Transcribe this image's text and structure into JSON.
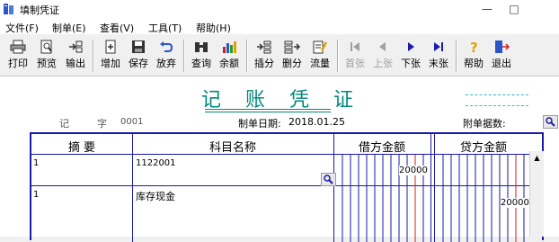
{
  "window": {
    "title": "填制凭证",
    "minimize": "—",
    "maximize": "□"
  },
  "menu": [
    "文件(F)",
    "制单(E)",
    "查看(V)",
    "工具(T)",
    "帮助(H)"
  ],
  "toolbar": {
    "print": "打印",
    "preview": "预览",
    "export": "输出",
    "add": "增加",
    "save": "保存",
    "discard": "放弃",
    "query": "查询",
    "balance": "余额",
    "insert_line": "插分",
    "delete_line": "删分",
    "cash_flow": "流量",
    "first": "首张",
    "prev": "上张",
    "next": "下张",
    "last": "末张",
    "help": "帮助",
    "exit": "退出"
  },
  "voucher": {
    "title": "记 账 凭 证",
    "type_label": "记",
    "number_label": "字",
    "number": "0001",
    "date_label": "制单日期:",
    "date": "2018.01.25",
    "attachments_label": "附单据数:"
  },
  "table": {
    "headers": {
      "summary": "摘 要",
      "account": "科目名称",
      "debit": "借方金额",
      "credit": "贷方金额"
    },
    "rows": [
      {
        "summary": "1",
        "account": "1122001",
        "debit": "20000",
        "credit": ""
      },
      {
        "summary": "1",
        "account": "库存现金",
        "debit": "",
        "credit": "20000"
      }
    ]
  },
  "colors": {
    "accent": "#00897b",
    "grid": "#1a1aa8",
    "red_line": "#d02020",
    "dash": "#34b6c8"
  }
}
